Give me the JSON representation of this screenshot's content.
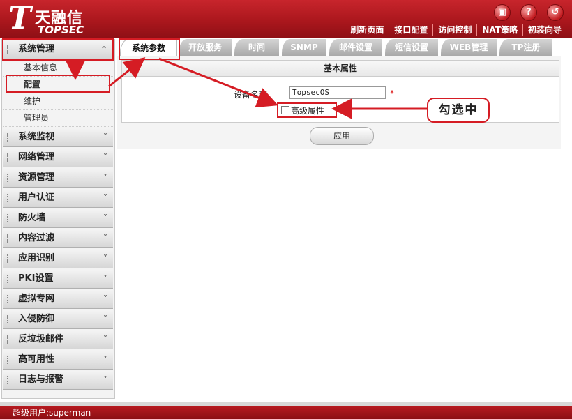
{
  "brand": {
    "name_cn": "天融信",
    "name_en": "TOPSEC"
  },
  "header_icons": [
    {
      "name": "save-icon",
      "glyph": "▣"
    },
    {
      "name": "help-icon",
      "glyph": "?"
    },
    {
      "name": "logout-icon",
      "glyph": "↺"
    }
  ],
  "topnav": [
    "刷新页面",
    "接口配置",
    "访问控制",
    "NAT策略",
    "初装向导"
  ],
  "sidebar": {
    "expanded": {
      "label": "系统管理",
      "chevron": "⌃"
    },
    "subitems": [
      "基本信息",
      "配置",
      "维护",
      "管理员"
    ],
    "groups": [
      "系统监视",
      "网络管理",
      "资源管理",
      "用户认证",
      "防火墙",
      "内容过滤",
      "应用识别",
      "PKI设置",
      "虚拟专网",
      "入侵防御",
      "反垃圾邮件",
      "高可用性",
      "日志与报警"
    ],
    "chevron": "˅"
  },
  "tabs": [
    "系统参数",
    "开放服务",
    "时间",
    "SNMP",
    "邮件设置",
    "短信设置",
    "WEB管理",
    "TP注册"
  ],
  "panel": {
    "title": "基本属性",
    "device_name_label": "设备名称",
    "device_name_value": "TopsecOS",
    "required_mark": "*",
    "advanced_label": "高级属性",
    "apply_label": "应用"
  },
  "callout": "勾选中",
  "footer": {
    "user_text": "超级用户:superman"
  },
  "colors": {
    "header_red": "#b51a20",
    "highlight_red": "#d51c24"
  }
}
